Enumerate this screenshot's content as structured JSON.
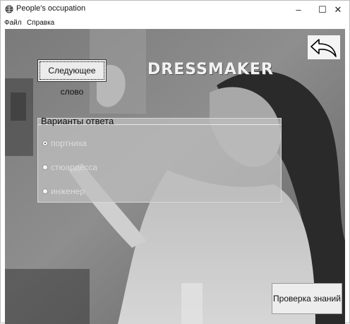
{
  "window": {
    "title": "People's occupation",
    "minimize_glyph": "–",
    "maximize_glyph": "☐",
    "close_glyph": "✕"
  },
  "menu": {
    "items": [
      "Файл",
      "Справка"
    ]
  },
  "main": {
    "next_word_button": "Следующее слово",
    "current_word": "DRESSMAKER",
    "answers_group": {
      "title": "Варианты ответа",
      "options": [
        {
          "label": "портниха",
          "selected": true
        },
        {
          "label": "стюардесса",
          "selected": false
        },
        {
          "label": "инженер",
          "selected": false
        }
      ]
    },
    "check_button": "Проверка знаний",
    "back_button_icon": "back-arrow-icon"
  }
}
